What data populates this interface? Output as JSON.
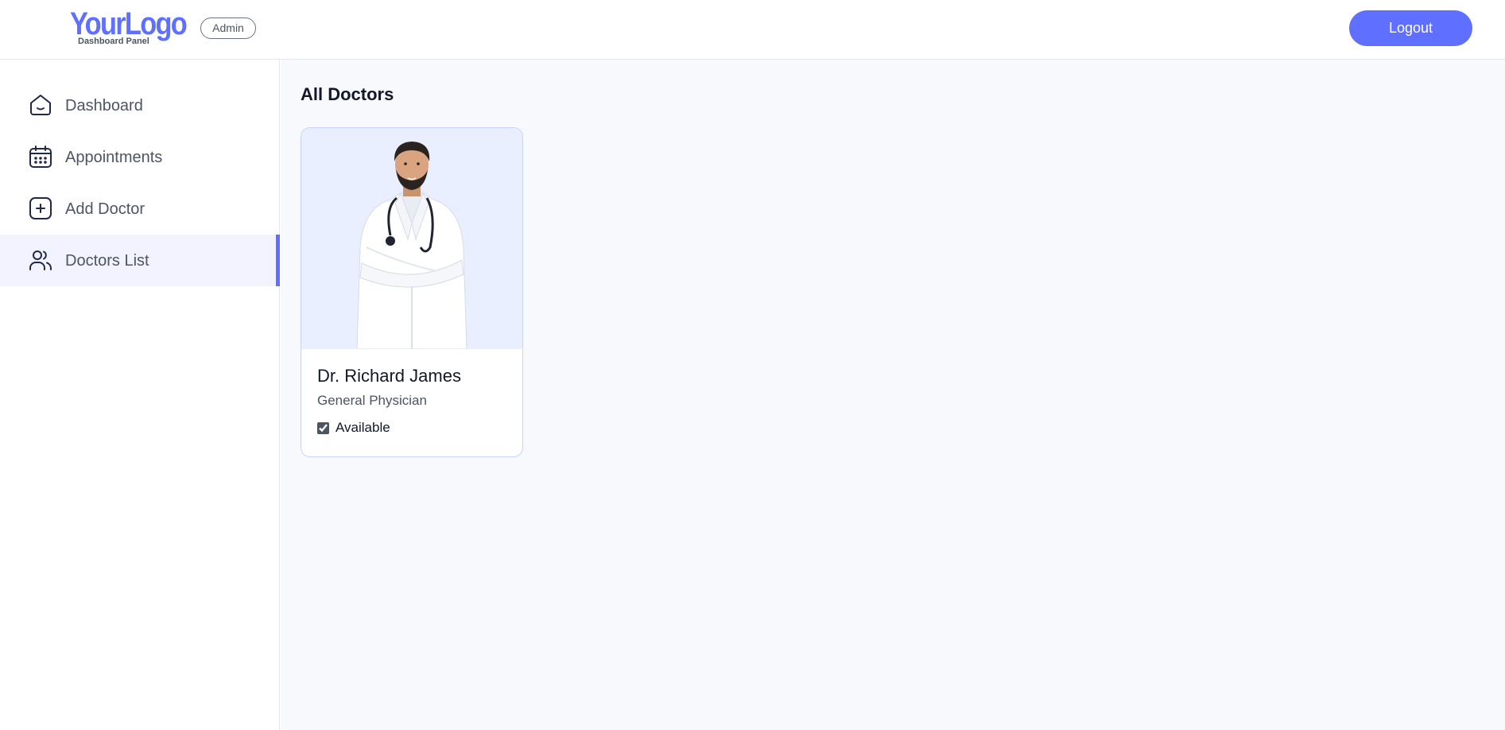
{
  "header": {
    "logo_main": "YourLogo",
    "logo_sub": "Dashboard Panel",
    "role_badge": "Admin",
    "logout_label": "Logout"
  },
  "sidebar": {
    "items": [
      {
        "label": "Dashboard",
        "icon": "home-icon",
        "active": false
      },
      {
        "label": "Appointments",
        "icon": "calendar-icon",
        "active": false
      },
      {
        "label": "Add Doctor",
        "icon": "add-square-icon",
        "active": false
      },
      {
        "label": "Doctors List",
        "icon": "people-icon",
        "active": true
      }
    ]
  },
  "main": {
    "title": "All Doctors",
    "doctors": [
      {
        "name": "Dr. Richard James",
        "speciality": "General Physician",
        "available": true,
        "availability_label": "Available"
      }
    ]
  },
  "colors": {
    "primary": "#5f6fff",
    "active_bg": "#f2f3ff",
    "main_bg": "#f8f9fd",
    "photo_bg": "#eaefff"
  }
}
